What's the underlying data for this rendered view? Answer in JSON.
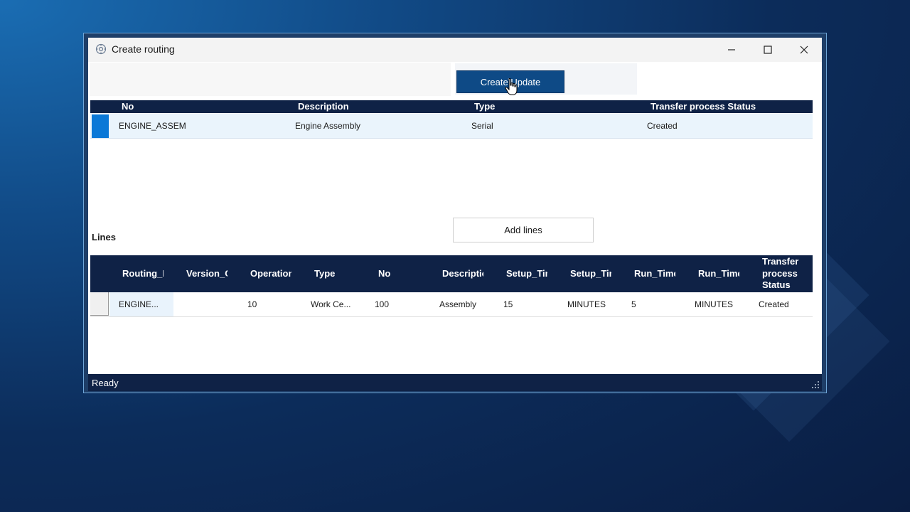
{
  "window": {
    "title": "Create routing"
  },
  "toolbar": {
    "create_update_label": "Create\\Update"
  },
  "header_grid": {
    "columns": [
      "No",
      "Description",
      "Type",
      "Transfer process Status"
    ],
    "rows": [
      {
        "no": "ENGINE_ASSEM",
        "description": "Engine Assembly",
        "type": "Serial",
        "status": "Created"
      }
    ]
  },
  "lines": {
    "label": "Lines",
    "add_lines_label": "Add lines",
    "columns": [
      "Routing_N",
      "Version_C",
      "Operation",
      "Type",
      "No",
      "Descriptio",
      "Setup_Tin",
      "Setup_Tin",
      "Run_Time",
      "Run_Time",
      "Transfer process Status"
    ],
    "rows": [
      {
        "routing_no": "ENGINE...",
        "version_code": "",
        "operation": "10",
        "type": "Work Ce...",
        "no": "100",
        "description": "Assembly",
        "setup_time": "15",
        "setup_time_unit": "MINUTES",
        "run_time": "5",
        "run_time_unit": "MINUTES",
        "status": "Created"
      }
    ]
  },
  "status_bar": {
    "text": "Ready"
  },
  "colors": {
    "accent": "#0e4a86",
    "grid_header": "#0f2246",
    "selection": "#0a78d7"
  }
}
